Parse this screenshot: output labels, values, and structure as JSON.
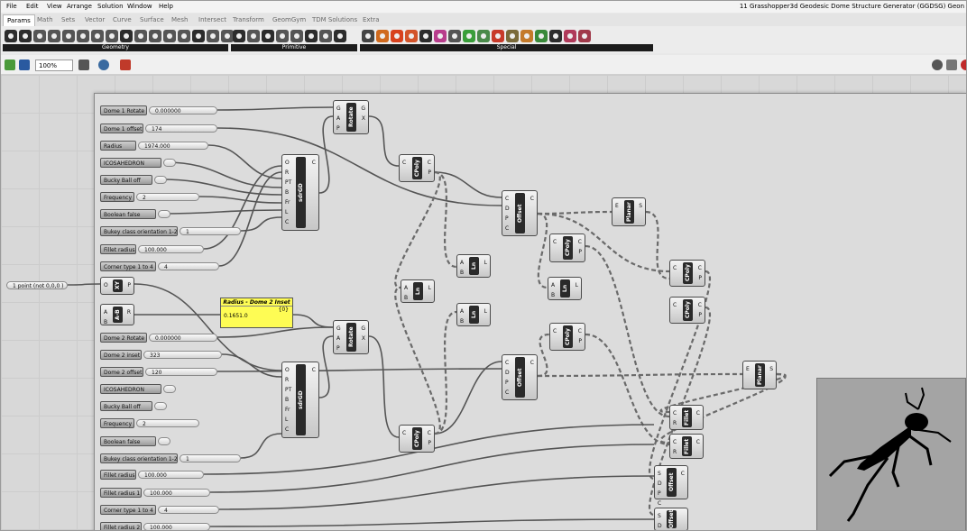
{
  "window": {
    "title": "11 Grasshopper3d Geodesic Dome Structure Generator (GGDSG) Geon"
  },
  "menu": [
    "File",
    "Edit",
    "View",
    "Arrange",
    "Solution",
    "Window",
    "Help"
  ],
  "tabs": [
    "Params",
    "Math",
    "Sets",
    "Vector",
    "Curve",
    "Surface",
    "Mesh",
    "Intersect",
    "Transform",
    "GeomGym",
    "TDM Solutions",
    "Extra"
  ],
  "active_tab": "Params",
  "ribbon_groups": [
    "Geometry",
    "Primitive",
    "Special"
  ],
  "toolbar": {
    "zoom": "100%"
  },
  "sliders": [
    {
      "label": "Dome 1 Rotate",
      "value": "0.000000"
    },
    {
      "label": "Dome 1 offset",
      "value": "174"
    },
    {
      "label": "Radius",
      "value": "1974.000"
    },
    {
      "label": "ICOSAHEDRON",
      "value": ""
    },
    {
      "label": "Bucky Ball off",
      "value": ""
    },
    {
      "label": "Frequency",
      "value": "2"
    },
    {
      "label": "Boolean false",
      "value": ""
    },
    {
      "label": "Bukey class orientation 1-2",
      "value": "1"
    },
    {
      "label": "Fillet radius",
      "value": "100.000"
    },
    {
      "label": "Corner type 1 to 4",
      "value": "4"
    },
    {
      "label": "1 point (not 0,0,0 )",
      "value": ""
    },
    {
      "label": "Dome 2 Rotate",
      "value": "0.000000"
    },
    {
      "label": "Dome 2 inset",
      "value": "323"
    },
    {
      "label": "Dome 2 offset",
      "value": "120"
    },
    {
      "label": "ICOSAHEDRON",
      "value": ""
    },
    {
      "label": "Bucky Ball off",
      "value": ""
    },
    {
      "label": "Frequency",
      "value": "2"
    },
    {
      "label": "Boolean false",
      "value": ""
    },
    {
      "label": "Bukey class orientation 1-2",
      "value": "1"
    },
    {
      "label": "Fillet radius",
      "value": "100.000"
    },
    {
      "label": "Fillet radius 1",
      "value": "100.000"
    },
    {
      "label": "Corner type 1 to 4",
      "value": "4"
    },
    {
      "label": "Fillet radius 2",
      "value": "100.000"
    }
  ],
  "components": [
    {
      "name": "Rotate",
      "inputs": "G\nA\nP",
      "outputs": "G\nX"
    },
    {
      "name": "sdrGD",
      "inputs": "O\nR\nPT\nB\nFr\nL\nC",
      "outputs": "C"
    },
    {
      "name": "CPoly",
      "inputs": "C",
      "outputs": "C\nP"
    },
    {
      "name": "Offset",
      "inputs": "C\nD\nP\nC",
      "outputs": "C"
    },
    {
      "name": "Planar",
      "inputs": "E",
      "outputs": "S"
    },
    {
      "name": "CPoly",
      "inputs": "C",
      "outputs": "C\nP"
    },
    {
      "name": "Ln",
      "inputs": "A\nB",
      "outputs": "L"
    },
    {
      "name": "CPoly",
      "inputs": "C",
      "outputs": "C\nP"
    },
    {
      "name": "XY",
      "inputs": "O",
      "outputs": "P"
    },
    {
      "name": "Ln",
      "inputs": "A\nB",
      "outputs": "L"
    },
    {
      "name": "Ln",
      "inputs": "A\nB",
      "outputs": "L"
    },
    {
      "name": "Ln",
      "inputs": "A\nB",
      "outputs": "L"
    },
    {
      "name": "CPoly",
      "inputs": "C",
      "outputs": "C\nP"
    },
    {
      "name": "A-B",
      "inputs": "A\nB",
      "outputs": "R"
    },
    {
      "name": "Rotate",
      "inputs": "G\nA\nP",
      "outputs": "G\nX"
    },
    {
      "name": "CPoly",
      "inputs": "C",
      "outputs": "C\nP"
    },
    {
      "name": "sdrGD",
      "inputs": "O\nR\nPT\nB\nFr\nL\nC",
      "outputs": "C"
    },
    {
      "name": "Offset",
      "inputs": "C\nD\nP\nC",
      "outputs": "C"
    },
    {
      "name": "Planar",
      "inputs": "E",
      "outputs": "S"
    },
    {
      "name": "CPoly",
      "inputs": "C",
      "outputs": "C\nP"
    },
    {
      "name": "Fillet",
      "inputs": "C\nR",
      "outputs": "C"
    },
    {
      "name": "Fillet",
      "inputs": "C\nR",
      "outputs": "C"
    },
    {
      "name": "Offset",
      "inputs": "S\nD\nP\nC",
      "outputs": "C"
    },
    {
      "name": "Offset",
      "inputs": "S\nD",
      "outputs": ""
    }
  ],
  "panel": {
    "title": "Radius - Dome 2 Inset",
    "index": "{0}",
    "value": "0.1651.0"
  },
  "colors": {
    "canvas": "#d8d8d8",
    "panel": "#fefc54",
    "wire": "#555555",
    "component": "#2a2a2a"
  }
}
